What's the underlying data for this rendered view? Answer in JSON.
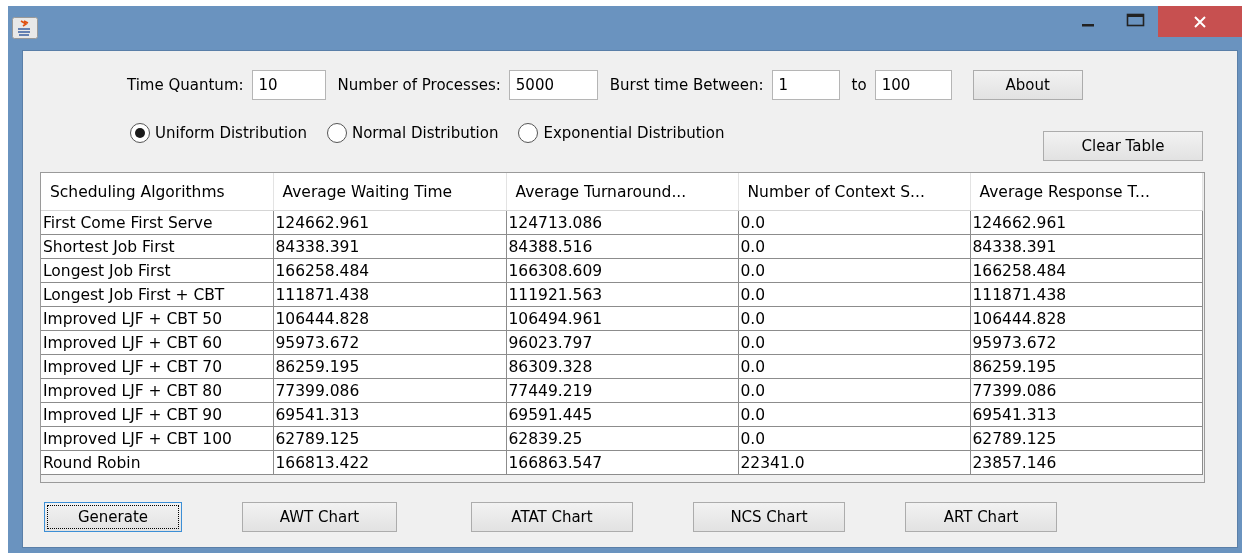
{
  "parameters": [
    {
      "label": "Time Quantum:",
      "value": "10"
    },
    {
      "label": "Number of Processes:",
      "value": "5000"
    },
    {
      "label": "Burst time Between:",
      "value": "1"
    },
    {
      "label": "to",
      "value": "100"
    }
  ],
  "about_button": "About",
  "distributions": [
    {
      "label": "Uniform Distribution",
      "selected": true
    },
    {
      "label": "Normal Distribution",
      "selected": false
    },
    {
      "label": "Exponential Distribution",
      "selected": false
    }
  ],
  "clear_button": "Clear Table",
  "table": {
    "columns": [
      "Scheduling Algorithms",
      "Average Waiting Time",
      "Average Turnaround...",
      "Number of Context S...",
      "Average Response T..."
    ],
    "rows": [
      [
        "First Come First Serve",
        "124662.961",
        "124713.086",
        "0.0",
        "124662.961"
      ],
      [
        "Shortest Job First",
        "84338.391",
        "84388.516",
        "0.0",
        "84338.391"
      ],
      [
        "Longest Job First",
        "166258.484",
        "166308.609",
        "0.0",
        "166258.484"
      ],
      [
        "Longest Job First + CBT",
        "111871.438",
        "111921.563",
        "0.0",
        "111871.438"
      ],
      [
        "Improved LJF + CBT 50",
        "106444.828",
        "106494.961",
        "0.0",
        "106444.828"
      ],
      [
        "Improved LJF + CBT 60",
        "95973.672",
        "96023.797",
        "0.0",
        "95973.672"
      ],
      [
        "Improved LJF + CBT 70",
        "86259.195",
        "86309.328",
        "0.0",
        "86259.195"
      ],
      [
        "Improved LJF + CBT 80",
        "77399.086",
        "77449.219",
        "0.0",
        "77399.086"
      ],
      [
        "Improved LJF + CBT 90",
        "69541.313",
        "69591.445",
        "0.0",
        "69541.313"
      ],
      [
        "Improved LJF + CBT 100",
        "62789.125",
        "62839.25",
        "0.0",
        "62789.125"
      ],
      [
        "Round Robin",
        "166813.422",
        "166863.547",
        "22341.0",
        "23857.146"
      ]
    ]
  },
  "buttons": [
    {
      "label": "Generate",
      "focused": true
    },
    {
      "label": "AWT Chart",
      "focused": false
    },
    {
      "label": "ATAT Chart",
      "focused": false
    },
    {
      "label": "NCS Chart",
      "focused": false
    },
    {
      "label": "ART Chart",
      "focused": false
    }
  ]
}
